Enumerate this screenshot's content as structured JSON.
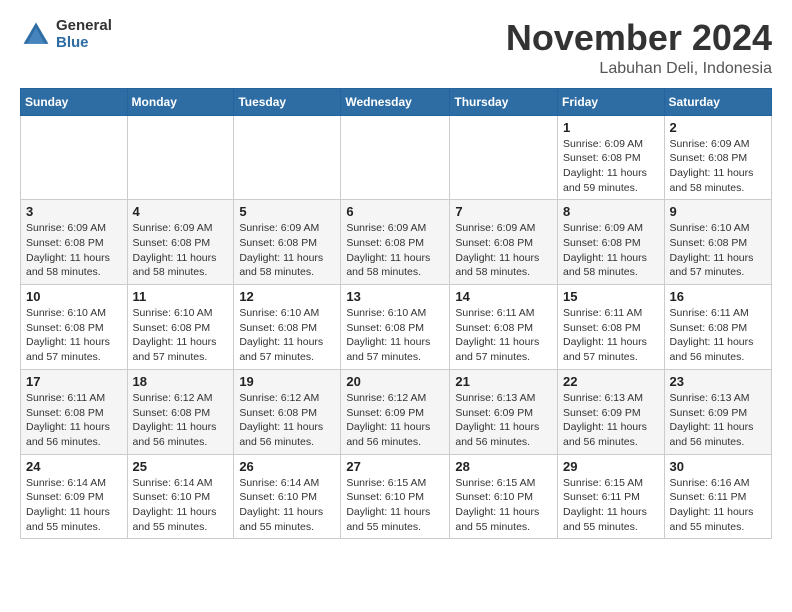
{
  "header": {
    "logo_general": "General",
    "logo_blue": "Blue",
    "month_title": "November 2024",
    "location": "Labuhan Deli, Indonesia"
  },
  "days_of_week": [
    "Sunday",
    "Monday",
    "Tuesday",
    "Wednesday",
    "Thursday",
    "Friday",
    "Saturday"
  ],
  "weeks": [
    [
      {
        "day": "",
        "info": ""
      },
      {
        "day": "",
        "info": ""
      },
      {
        "day": "",
        "info": ""
      },
      {
        "day": "",
        "info": ""
      },
      {
        "day": "",
        "info": ""
      },
      {
        "day": "1",
        "info": "Sunrise: 6:09 AM\nSunset: 6:08 PM\nDaylight: 11 hours and 59 minutes."
      },
      {
        "day": "2",
        "info": "Sunrise: 6:09 AM\nSunset: 6:08 PM\nDaylight: 11 hours and 58 minutes."
      }
    ],
    [
      {
        "day": "3",
        "info": "Sunrise: 6:09 AM\nSunset: 6:08 PM\nDaylight: 11 hours and 58 minutes."
      },
      {
        "day": "4",
        "info": "Sunrise: 6:09 AM\nSunset: 6:08 PM\nDaylight: 11 hours and 58 minutes."
      },
      {
        "day": "5",
        "info": "Sunrise: 6:09 AM\nSunset: 6:08 PM\nDaylight: 11 hours and 58 minutes."
      },
      {
        "day": "6",
        "info": "Sunrise: 6:09 AM\nSunset: 6:08 PM\nDaylight: 11 hours and 58 minutes."
      },
      {
        "day": "7",
        "info": "Sunrise: 6:09 AM\nSunset: 6:08 PM\nDaylight: 11 hours and 58 minutes."
      },
      {
        "day": "8",
        "info": "Sunrise: 6:09 AM\nSunset: 6:08 PM\nDaylight: 11 hours and 58 minutes."
      },
      {
        "day": "9",
        "info": "Sunrise: 6:10 AM\nSunset: 6:08 PM\nDaylight: 11 hours and 57 minutes."
      }
    ],
    [
      {
        "day": "10",
        "info": "Sunrise: 6:10 AM\nSunset: 6:08 PM\nDaylight: 11 hours and 57 minutes."
      },
      {
        "day": "11",
        "info": "Sunrise: 6:10 AM\nSunset: 6:08 PM\nDaylight: 11 hours and 57 minutes."
      },
      {
        "day": "12",
        "info": "Sunrise: 6:10 AM\nSunset: 6:08 PM\nDaylight: 11 hours and 57 minutes."
      },
      {
        "day": "13",
        "info": "Sunrise: 6:10 AM\nSunset: 6:08 PM\nDaylight: 11 hours and 57 minutes."
      },
      {
        "day": "14",
        "info": "Sunrise: 6:11 AM\nSunset: 6:08 PM\nDaylight: 11 hours and 57 minutes."
      },
      {
        "day": "15",
        "info": "Sunrise: 6:11 AM\nSunset: 6:08 PM\nDaylight: 11 hours and 57 minutes."
      },
      {
        "day": "16",
        "info": "Sunrise: 6:11 AM\nSunset: 6:08 PM\nDaylight: 11 hours and 56 minutes."
      }
    ],
    [
      {
        "day": "17",
        "info": "Sunrise: 6:11 AM\nSunset: 6:08 PM\nDaylight: 11 hours and 56 minutes."
      },
      {
        "day": "18",
        "info": "Sunrise: 6:12 AM\nSunset: 6:08 PM\nDaylight: 11 hours and 56 minutes."
      },
      {
        "day": "19",
        "info": "Sunrise: 6:12 AM\nSunset: 6:08 PM\nDaylight: 11 hours and 56 minutes."
      },
      {
        "day": "20",
        "info": "Sunrise: 6:12 AM\nSunset: 6:09 PM\nDaylight: 11 hours and 56 minutes."
      },
      {
        "day": "21",
        "info": "Sunrise: 6:13 AM\nSunset: 6:09 PM\nDaylight: 11 hours and 56 minutes."
      },
      {
        "day": "22",
        "info": "Sunrise: 6:13 AM\nSunset: 6:09 PM\nDaylight: 11 hours and 56 minutes."
      },
      {
        "day": "23",
        "info": "Sunrise: 6:13 AM\nSunset: 6:09 PM\nDaylight: 11 hours and 56 minutes."
      }
    ],
    [
      {
        "day": "24",
        "info": "Sunrise: 6:14 AM\nSunset: 6:09 PM\nDaylight: 11 hours and 55 minutes."
      },
      {
        "day": "25",
        "info": "Sunrise: 6:14 AM\nSunset: 6:10 PM\nDaylight: 11 hours and 55 minutes."
      },
      {
        "day": "26",
        "info": "Sunrise: 6:14 AM\nSunset: 6:10 PM\nDaylight: 11 hours and 55 minutes."
      },
      {
        "day": "27",
        "info": "Sunrise: 6:15 AM\nSunset: 6:10 PM\nDaylight: 11 hours and 55 minutes."
      },
      {
        "day": "28",
        "info": "Sunrise: 6:15 AM\nSunset: 6:10 PM\nDaylight: 11 hours and 55 minutes."
      },
      {
        "day": "29",
        "info": "Sunrise: 6:15 AM\nSunset: 6:11 PM\nDaylight: 11 hours and 55 minutes."
      },
      {
        "day": "30",
        "info": "Sunrise: 6:16 AM\nSunset: 6:11 PM\nDaylight: 11 hours and 55 minutes."
      }
    ]
  ]
}
